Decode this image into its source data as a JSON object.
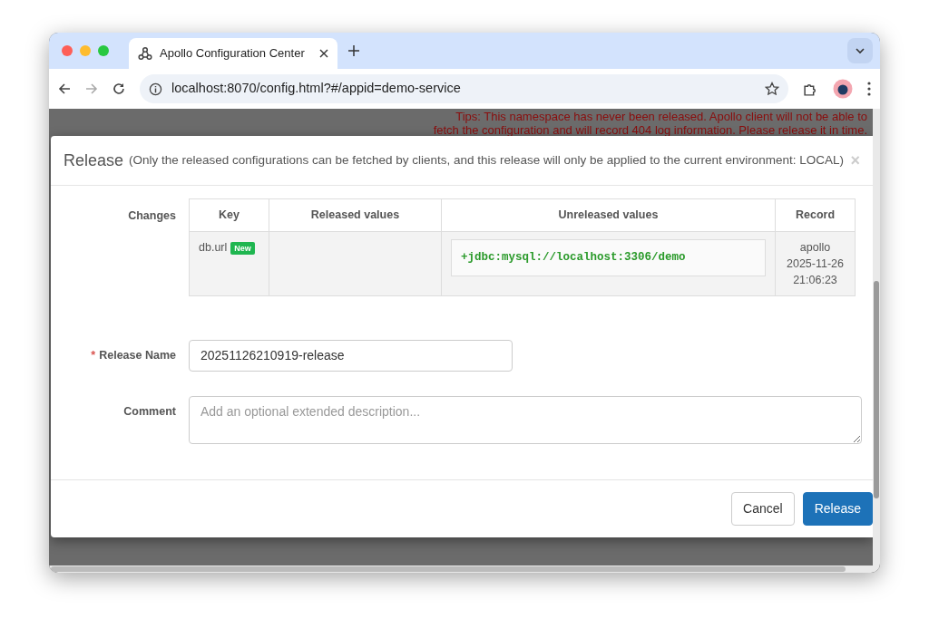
{
  "browser": {
    "tab": {
      "title": "Apollo Configuration Center",
      "selected": true
    },
    "address": "localhost:8070/config.html?#/appid=demo-service"
  },
  "page": {
    "tips": [
      "Tips: This namespace has never been released. Apollo client will not be able to",
      "fetch the configuration and will record 404 log information. Please release it in time."
    ]
  },
  "modal": {
    "title": "Release",
    "subtitle": "(Only the released configurations can be fetched by clients, and this release will only be applied to the current environment: LOCAL)",
    "close": "×",
    "changes": {
      "label": "Changes",
      "columns": [
        "Key",
        "Released values",
        "Unreleased values",
        "Record"
      ],
      "rows": [
        {
          "key": "db.url",
          "badge": "New",
          "unreleased": "+jdbc:mysql://localhost:3306/demo",
          "record": [
            "apollo",
            "2025-11-26",
            "21:06:23"
          ]
        }
      ]
    },
    "release_name": {
      "label": "Release Name",
      "required_mark": "*",
      "value": "20251126210919-release"
    },
    "comment": {
      "label": "Comment",
      "placeholder": "Add an optional extended description..."
    },
    "buttons": [
      {
        "label": "Cancel",
        "kind": "default"
      },
      {
        "label": "Release",
        "kind": "primary"
      }
    ]
  }
}
